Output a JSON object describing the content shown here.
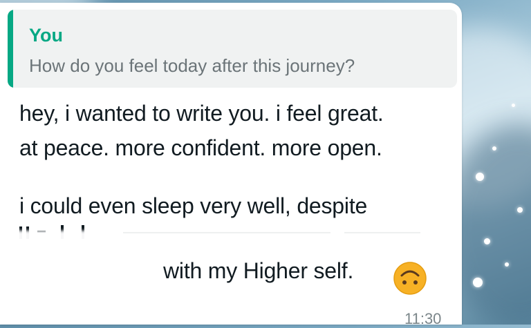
{
  "colors": {
    "accent": "#06a884",
    "bubble_background": "#ffffff",
    "quote_background": "#f0f2f2",
    "message_text": "#111b21",
    "quote_text": "#6b7478",
    "meta_text": "#7a8589",
    "emoji_fill": "#f7b125"
  },
  "quoted_message": {
    "author": "You",
    "text": "How do you feel today after this journey?"
  },
  "message": {
    "line1": "hey, i wanted to write you. i feel great.",
    "line2": "at peace. more confident. more open.",
    "line3": "i could even sleep very well, despite",
    "line4_visible": "with my Higher self.",
    "emoji": "upside-down-face-emoji",
    "time": "11:30"
  }
}
